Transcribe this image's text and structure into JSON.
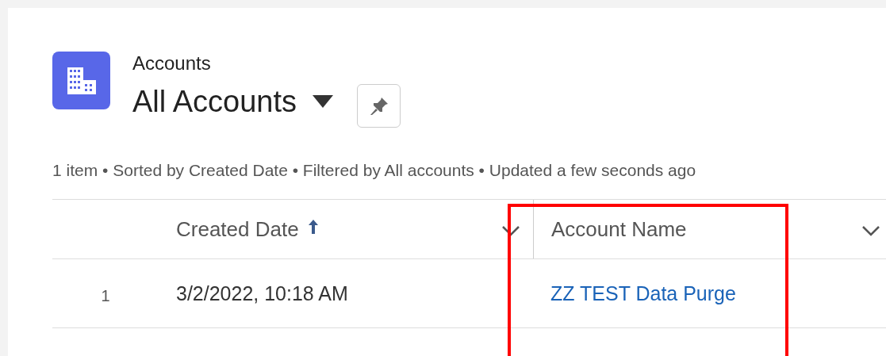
{
  "header": {
    "object_label": "Accounts",
    "list_view": "All Accounts"
  },
  "summary": "1 item • Sorted by Created Date • Filtered by All accounts • Updated a few seconds ago",
  "table": {
    "columns": [
      {
        "label": "Created Date",
        "sorted_ascending": true
      },
      {
        "label": "Account Name",
        "sorted_ascending": false
      }
    ],
    "rows": [
      {
        "number": "1",
        "created_date": "3/2/2022, 10:18 AM",
        "account_name": "ZZ TEST Data Purge"
      }
    ]
  }
}
